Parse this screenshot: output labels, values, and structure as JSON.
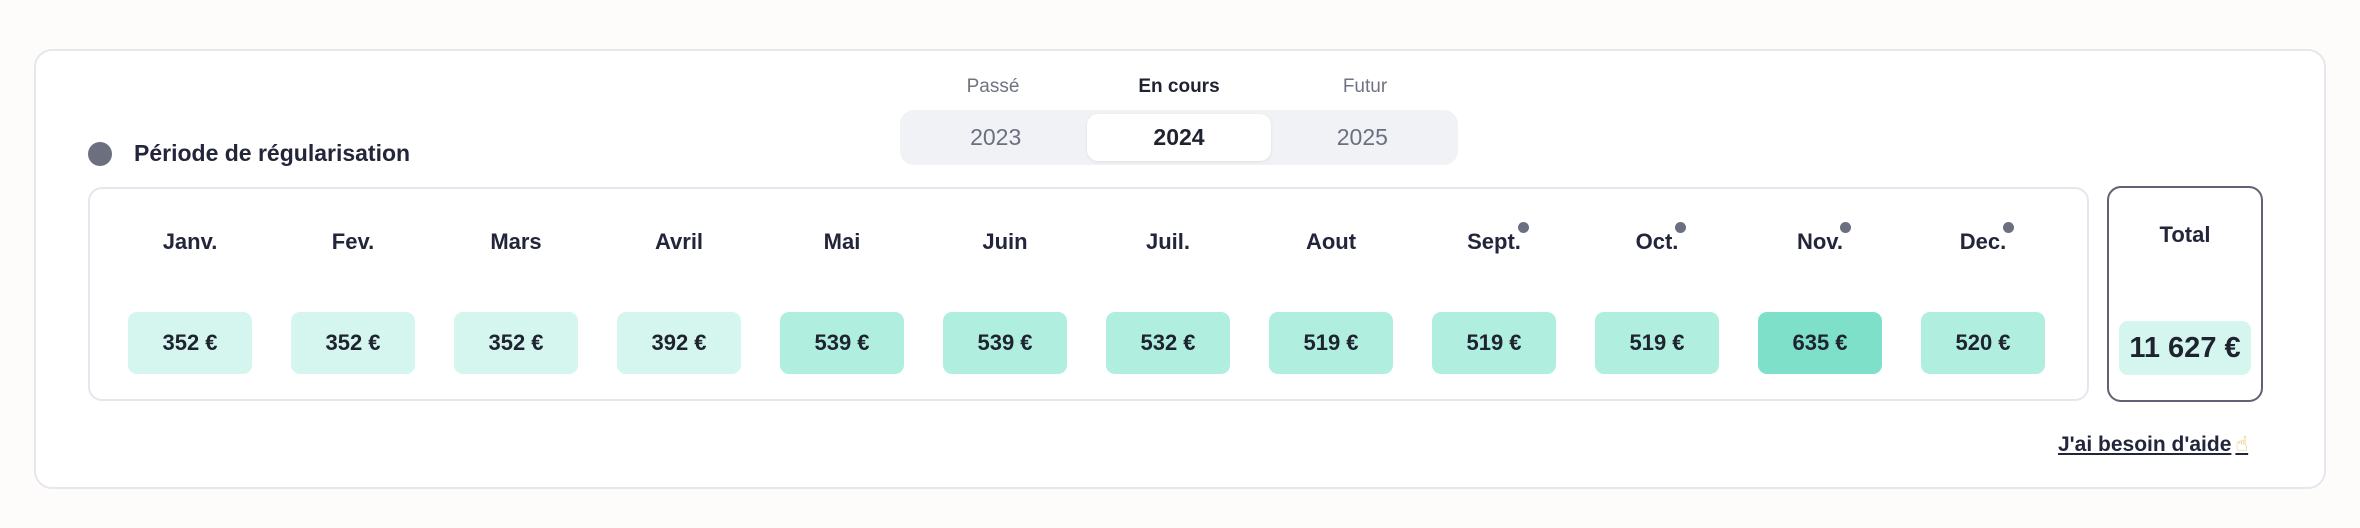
{
  "legend": {
    "label": "Période de régularisation",
    "dot_color": "#6b6f80"
  },
  "years": {
    "labels": [
      "Passé",
      "En cours",
      "Futur"
    ],
    "values": [
      "2023",
      "2024",
      "2025"
    ],
    "selected_index": 1
  },
  "months": [
    {
      "name": "Janv.",
      "value": "352 €",
      "regularisation": false,
      "level": "low"
    },
    {
      "name": "Fev.",
      "value": "352 €",
      "regularisation": false,
      "level": "low"
    },
    {
      "name": "Mars",
      "value": "352 €",
      "regularisation": false,
      "level": "low"
    },
    {
      "name": "Avril",
      "value": "392 €",
      "regularisation": false,
      "level": "low"
    },
    {
      "name": "Mai",
      "value": "539 €",
      "regularisation": false,
      "level": "mid"
    },
    {
      "name": "Juin",
      "value": "539 €",
      "regularisation": false,
      "level": "mid"
    },
    {
      "name": "Juil.",
      "value": "532 €",
      "regularisation": false,
      "level": "mid"
    },
    {
      "name": "Aout",
      "value": "519 €",
      "regularisation": false,
      "level": "mid"
    },
    {
      "name": "Sept.",
      "value": "519 €",
      "regularisation": true,
      "level": "mid"
    },
    {
      "name": "Oct.",
      "value": "519 €",
      "regularisation": true,
      "level": "mid"
    },
    {
      "name": "Nov.",
      "value": "635 €",
      "regularisation": true,
      "level": "high"
    },
    {
      "name": "Dec.",
      "value": "520 €",
      "regularisation": true,
      "level": "mid"
    }
  ],
  "level_colors": {
    "low": "#d4f6ee",
    "mid": "#b0efe0",
    "high": "#7ee0c8"
  },
  "total": {
    "label": "Total",
    "value": "11 627 €"
  },
  "help": {
    "label": "J'ai besoin d'aide",
    "icon": "pointing-hand-icon"
  }
}
